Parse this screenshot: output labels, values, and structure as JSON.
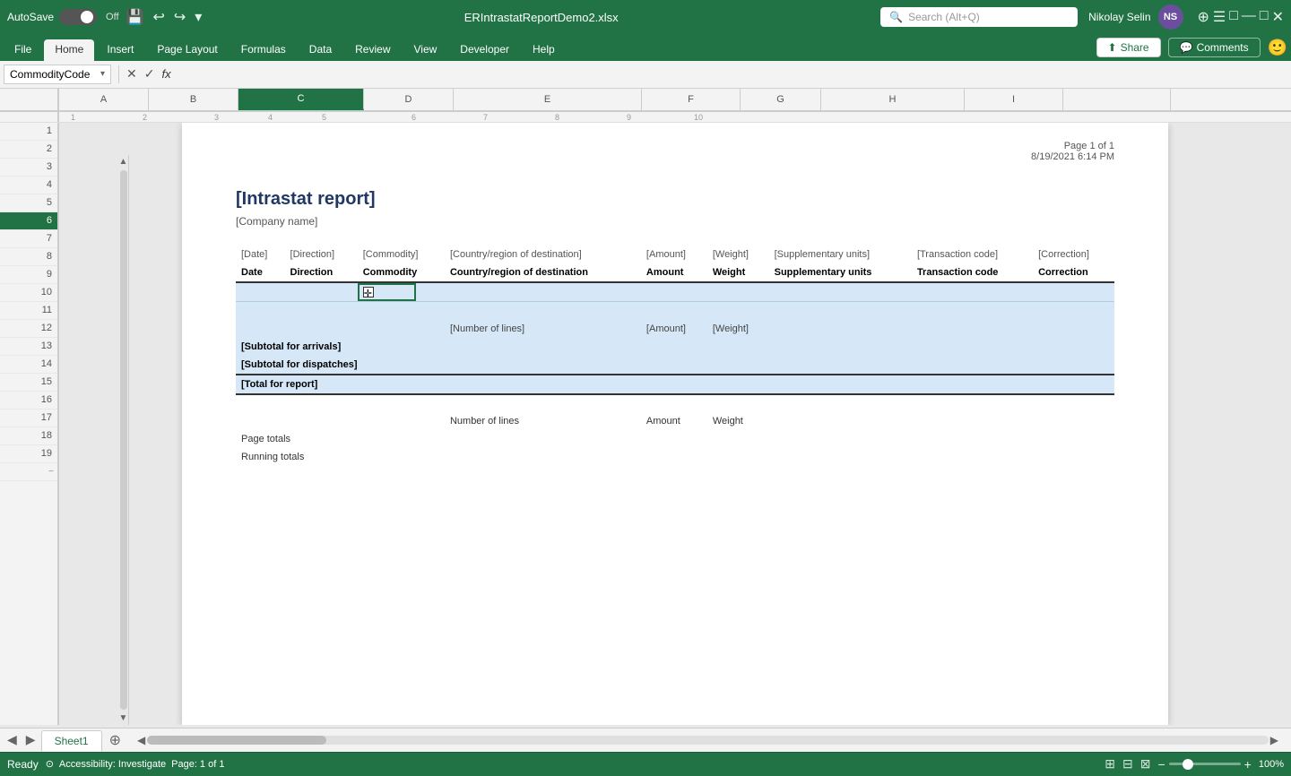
{
  "titlebar": {
    "autosave_label": "AutoSave",
    "autosave_state": "Off",
    "filename": "ERIntrastatReportDemo2.xlsx",
    "search_placeholder": "Search (Alt+Q)",
    "username": "Nikolay Selin",
    "user_initials": "NS"
  },
  "ribbon": {
    "tabs": [
      "File",
      "Home",
      "Insert",
      "Page Layout",
      "Formulas",
      "Data",
      "Review",
      "View",
      "Developer",
      "Help"
    ],
    "active_tab": "Home",
    "share_label": "Share",
    "comments_label": "Comments"
  },
  "formula_bar": {
    "name_box": "CommodityCode",
    "fx_label": "fx"
  },
  "columns": {
    "headers": [
      "A",
      "B",
      "C",
      "D",
      "E",
      "F",
      "G",
      "H",
      "I"
    ],
    "active_col": "C"
  },
  "rows": {
    "numbers": [
      "1",
      "2",
      "3",
      "4",
      "5",
      "6",
      "7",
      "8",
      "9",
      "10",
      "11",
      "12",
      "13",
      "14",
      "15",
      "16",
      "17",
      "18",
      "19"
    ],
    "active_row": "6"
  },
  "page": {
    "page_info_label": "Page 1 of",
    "page_total": "1",
    "timestamp": "8/19/2021 6:14 PM"
  },
  "report": {
    "title": "[Intrastat report]",
    "company": "[Company name]",
    "col_headers_row1": [
      "[Date]",
      "[Direction]",
      "[Commodity]",
      "",
      "[Country/region of destination]",
      "[Amount]",
      "[Weight]",
      "[Supplementary units]",
      "[Transaction code]",
      "[Correction]"
    ],
    "col_headers_row2": [
      "Date",
      "Direction",
      "Commodity",
      "",
      "Country/region of destination",
      "Amount",
      "Weight",
      "Supplementary units",
      "Transaction code",
      "Correction"
    ],
    "summary_cols": [
      "[Number of lines]",
      "[Amount]",
      "[Weight]"
    ],
    "subtotal_arrivals": "[Subtotal for arrivals]",
    "subtotal_dispatches": "[Subtotal for dispatches]",
    "total_report": "[Total for report]",
    "footer_headers": [
      "Number of lines",
      "Amount",
      "Weight"
    ],
    "footer_row1": "Page totals",
    "footer_row2": "Running totals"
  },
  "statusbar": {
    "ready_label": "Ready",
    "page_label": "Page: 1 of 1",
    "accessibility_label": "Accessibility: Investigate",
    "zoom_level": "100%"
  },
  "sheet_tabs": {
    "tabs": [
      "Sheet1"
    ],
    "active_tab": "Sheet1"
  }
}
